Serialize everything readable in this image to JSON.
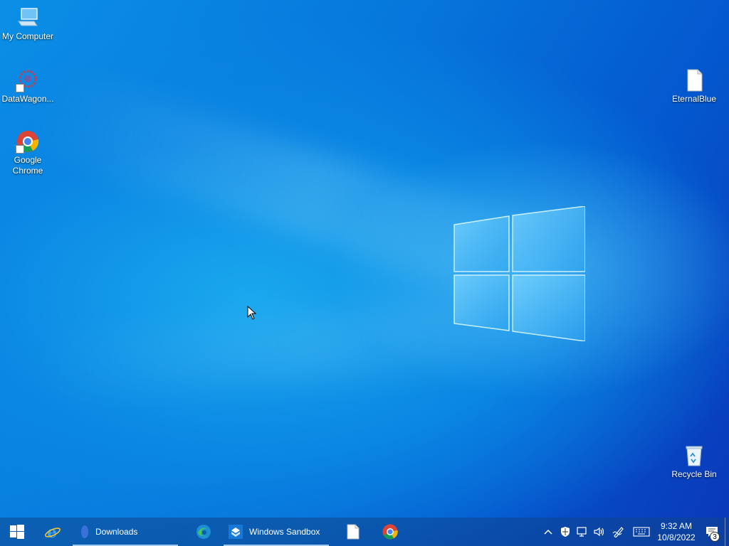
{
  "desktop": {
    "icons": [
      {
        "label": "My Computer",
        "icon": "computer-icon"
      },
      {
        "label": "DataWagon...",
        "icon": "datawagon-icon"
      },
      {
        "label": "Google Chrome",
        "icon": "chrome-icon"
      },
      {
        "label": "EternalBlue",
        "icon": "file-icon"
      },
      {
        "label": "Recycle Bin",
        "icon": "recycle-bin-icon"
      }
    ]
  },
  "taskbar": {
    "start_icon": "windows-start-icon",
    "apps": [
      {
        "icon": "internet-explorer-icon"
      },
      {
        "label": "Downloads",
        "icon": "folder-icon"
      },
      {
        "icon": "edge-icon"
      },
      {
        "label": "Windows Sandbox",
        "icon": "sandbox-icon"
      },
      {
        "icon": "file-icon"
      },
      {
        "icon": "chrome-icon"
      }
    ],
    "tray": {
      "icons": [
        "chevron-up-icon",
        "security-shield-icon",
        "network-icon",
        "volume-icon",
        "pen-icon",
        "keyboard-icon"
      ],
      "time": "9:32 AM",
      "date": "10/8/2022",
      "notification_count": "3"
    }
  },
  "colors": {
    "accent": "#0a78dc",
    "taskbar": "#0e468c"
  }
}
